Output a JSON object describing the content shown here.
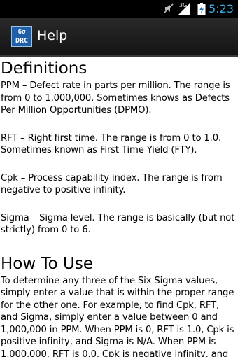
{
  "status_bar": {
    "network": "3G",
    "time": "5:23"
  },
  "action_bar": {
    "icon_text_top": "6σ",
    "icon_text_bottom": "DRC",
    "title": "Help"
  },
  "sections": [
    {
      "heading": "Definitions",
      "paragraphs": [
        "PPM – Defect rate in parts per million. The range is from 0 to 1,000,000. Sometimes knows as Defects Per Million Opportunities (DPMO).",
        "RFT – Right first time. The range is from 0 to 1.0. Sometimes known as First Time Yield (FTY).",
        "Cpk – Process capability index. The range is from negative to positive infinity.",
        "Sigma – Sigma level. The range is basically (but not strictly) from 0 to 6."
      ]
    },
    {
      "heading": "How To Use",
      "paragraphs": [
        "To determine any three of the Six Sigma values, simply enter a value that is within the proper range for the other one. For example, to find Cpk, RFT, and Sigma, simply enter a value between 0 and 1,000,000 in PPM. When PPM is 0, RFT is 1.0, Cpk is positive infinity, and Sigma is N/A. When PPM is 1,000,000, RFT is 0.0, Cpk is negative infinity, and"
      ]
    }
  ],
  "colors": {
    "status_time": "#3aa8e0",
    "app_icon_bg": "#1f5fa8"
  }
}
